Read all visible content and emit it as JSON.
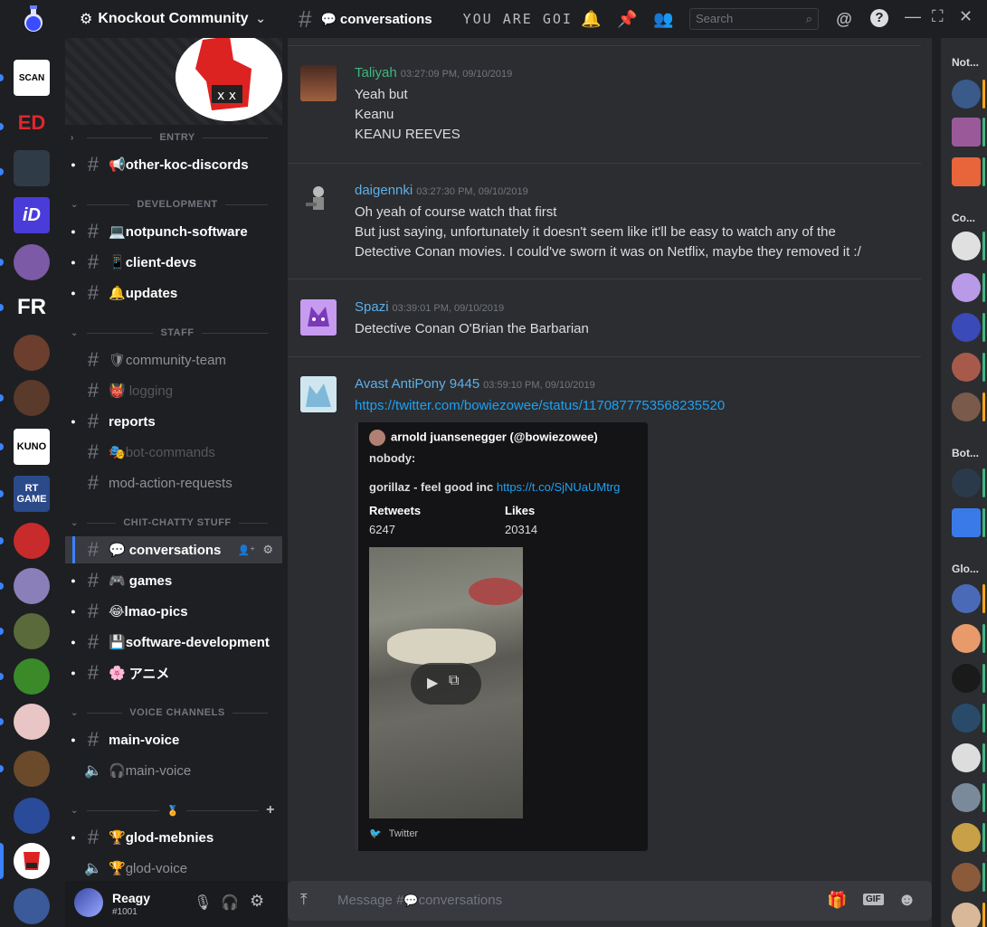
{
  "server": {
    "name": "Knockout Community"
  },
  "header": {
    "channel": "conversations",
    "topic": "YOU ARE GOING",
    "search_placeholder": "Search"
  },
  "sidebar": {
    "categories": [
      {
        "name": "ENTRY"
      },
      {
        "name": "DEVELOPMENT"
      },
      {
        "name": "STAFF"
      },
      {
        "name": "CHIT-CHATTY STUFF"
      },
      {
        "name": "VOICE CHANNELS"
      }
    ],
    "channels": [
      {
        "name": "other-koc-discords",
        "emoji": "📢"
      },
      {
        "name": "notpunch-software",
        "emoji": "💻"
      },
      {
        "name": "client-devs",
        "emoji": "📱"
      },
      {
        "name": "updates",
        "emoji": "🔔"
      },
      {
        "name": "community-team",
        "emoji": "🛡"
      },
      {
        "name": "logging",
        "emoji": "👹"
      },
      {
        "name": "reports",
        "emoji": ""
      },
      {
        "name": "bot-commands",
        "emoji": "🎭"
      },
      {
        "name": "mod-action-requests",
        "emoji": ""
      },
      {
        "name": "conversations",
        "emoji": "💬"
      },
      {
        "name": "games",
        "emoji": "🎮"
      },
      {
        "name": "lmao-pics",
        "emoji": "😂"
      },
      {
        "name": "software-development",
        "emoji": "💾"
      },
      {
        "name": "アニメ",
        "emoji": "🌸"
      },
      {
        "name": "main-voice",
        "emoji": ""
      },
      {
        "name": "main-voice",
        "emoji": "🎧"
      },
      {
        "name": "glod-mebnies",
        "emoji": "🏆"
      },
      {
        "name": "glod-voice",
        "emoji": "🏆"
      }
    ]
  },
  "user": {
    "name": "Reagy",
    "tag": "#1001"
  },
  "messages": [
    {
      "author": "Taliyah",
      "color": "#43b581",
      "time": "03:27:09 PM, 09/10/2019",
      "lines": [
        "Yeah but",
        "Keanu",
        "KEANU REEVES"
      ]
    },
    {
      "author": "daigennki",
      "color": "#5eafe8",
      "time": "03:27:30 PM, 09/10/2019",
      "lines": [
        "Oh yeah of course watch that first",
        "But just saying, unfortunately it doesn't seem like it'll be easy to watch any of the",
        "Detective Conan movies. I could've sworn it was on Netflix, maybe they removed it :/"
      ]
    },
    {
      "author": "Spazi",
      "color": "#5eafe8",
      "time": "03:39:01 PM, 09/10/2019",
      "lines": [
        "Detective Conan O'Brian the Barbarian"
      ]
    },
    {
      "author": "Avast AntiPony 9445",
      "color": "#5eafe8",
      "time": "03:59:10 PM, 09/10/2019",
      "link": "https://twitter.com/bowiezowee/status/1170877753568235520"
    }
  ],
  "embed": {
    "author": "arnold juansenegger (@bowiezowee)",
    "line1": "nobody:",
    "line2": "gorillaz - feel good inc",
    "line2_link": "https://t.co/SjNUaUMtrg",
    "retweets_label": "Retweets",
    "retweets": "6247",
    "likes_label": "Likes",
    "likes": "20314",
    "footer": "Twitter"
  },
  "input": {
    "prefix": "Message #",
    "channel": "conversations"
  },
  "members": {
    "categories": [
      "Not...",
      "Co...",
      "Bot...",
      "Glo..."
    ]
  },
  "rail": {
    "labels": [
      "SCAN",
      "FR",
      "KUNO",
      "RT GAME"
    ]
  }
}
